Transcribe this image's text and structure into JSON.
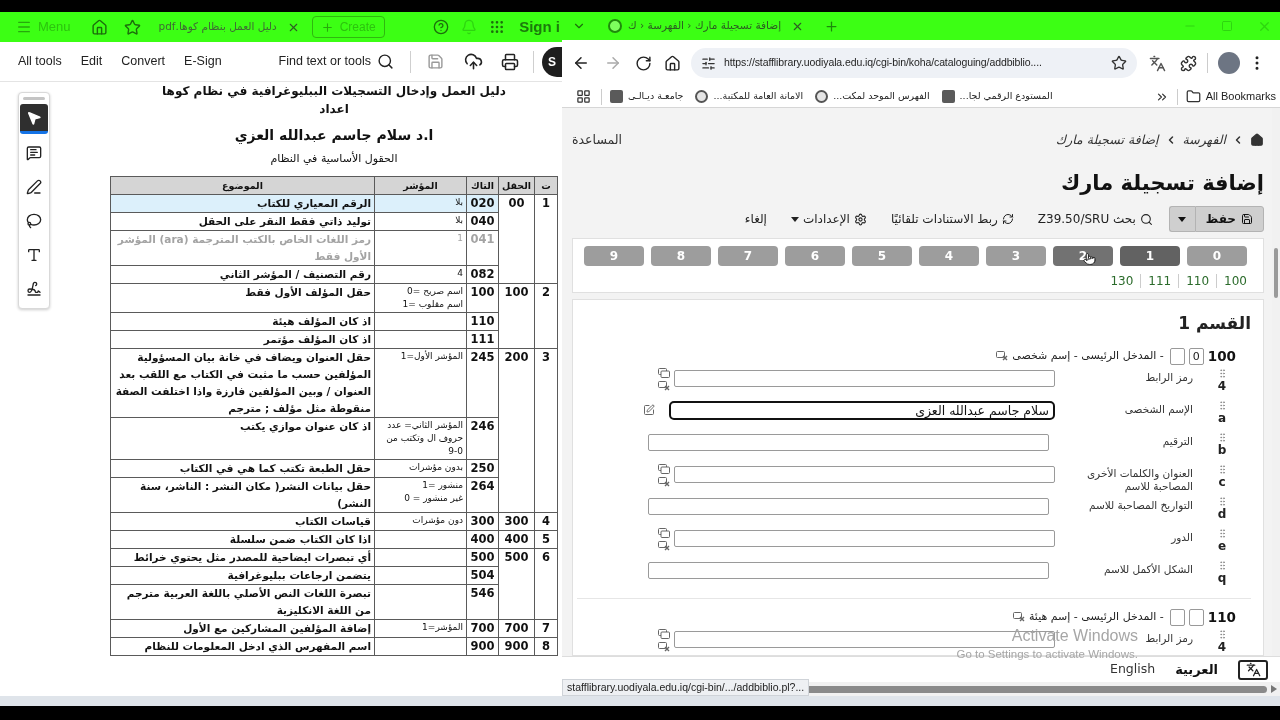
{
  "acrobat": {
    "tab_bar": {
      "menu_label": "Menu",
      "tab_title": "دليل العمل بنظام كوها.pdf",
      "create_label": "Create",
      "sign_in_label": "Sign i"
    },
    "toolbar": {
      "all_tools": "All tools",
      "edit": "Edit",
      "convert": "Convert",
      "e_sign": "E-Sign",
      "search_label": "Find text or tools",
      "account_initial": "S"
    },
    "tools": [
      {
        "kind": "select",
        "selected": true
      },
      {
        "kind": "comment",
        "selected": false
      },
      {
        "kind": "draw",
        "selected": false
      },
      {
        "kind": "lasso",
        "selected": false
      },
      {
        "kind": "text",
        "selected": false
      },
      {
        "kind": "sign",
        "selected": false
      }
    ],
    "document": {
      "title": "دليل العمل وإدخال التسجيلات الببليوغرافية في نظام كوها",
      "prepared_by": "اعداد",
      "author": "ا.د سلام جاسم عبدالله العزي",
      "subtitle": "الحقول الأساسية في النظام",
      "table": {
        "columns": [
          "ت",
          "الحقل",
          "التاك",
          "المؤشر",
          "الموضوع"
        ],
        "groups": [
          {
            "number": "1",
            "field": "00",
            "rows": [
              {
                "tag": "020",
                "indicator": [
                  "بلا"
                ],
                "subject": "الرقم المعياري للكتاب",
                "highlighted": true,
                "faded": false
              },
              {
                "tag": "040",
                "indicator": [
                  "بلا"
                ],
                "subject": "توليد ذاتي فقط النقر على الحقل",
                "highlighted": false,
                "faded": false
              },
              {
                "tag": "041",
                "indicator": [
                  "1"
                ],
                "subject": "رمز اللغات الخاص بالكتب المترجمة (ara) المؤشر الأول فقط",
                "highlighted": false,
                "faded": true
              },
              {
                "tag": "082",
                "indicator": [
                  "4"
                ],
                "subject": "رقم التصنيف / المؤشر الثاني",
                "highlighted": false,
                "faded": false
              }
            ]
          },
          {
            "number": "2",
            "field": "100",
            "rows": [
              {
                "tag": "100",
                "indicator": [
                  "0= اسم صريح",
                  "1= اسم مقلوب"
                ],
                "subject": "حقل المؤلف الأول فقط",
                "highlighted": false,
                "faded": false
              },
              {
                "tag": "110",
                "subject": "اذ كان المؤلف هيئة",
                "highlighted": false,
                "faded": false
              },
              {
                "tag": "111",
                "subject": "اذ كان المؤلف مؤتمر",
                "highlighted": false,
                "faded": false
              }
            ]
          },
          {
            "number": "3",
            "field": "200",
            "rows": [
              {
                "tag": "245",
                "indicator": [
                  "المؤشر الأول=1"
                ],
                "subject": "حقل العنوان ويضاف في خانة بيان المسؤولية المؤلفين حسب ما مثبت في الكتاب مع اللقب بعد العنوان / وبين المؤلفين فارزة واذا اختلفت الصفة منقوطة مثل مؤلف ; مترجم",
                "highlighted": false,
                "faded": false
              },
              {
                "tag": "246",
                "indicator": [
                  "المؤشر الثاني= عدد حروف ال وتكتب من 0-9"
                ],
                "subject": "اذ كان عنوان موازي يكتب",
                "highlighted": false,
                "faded": false
              },
              {
                "tag": "250",
                "indicator": [
                  "بدون مؤشرات"
                ],
                "subject": "حقل الطبعة تكتب كما هي في الكتاب",
                "highlighted": false,
                "faded": false
              },
              {
                "tag": "264",
                "indicator": [
                  "1= منشور",
                  "0 = غير منشور"
                ],
                "subject": "حقل بيانات النشر( مكان النشر : الناشر، سنة النشر)",
                "highlighted": false,
                "faded": false
              }
            ]
          },
          {
            "number": "4",
            "field": "300",
            "rows": [
              {
                "tag": "300",
                "indicator": [
                  "دون مؤشرات"
                ],
                "subject": "قياسات الكتاب",
                "highlighted": false,
                "faded": false
              }
            ]
          },
          {
            "number": "5",
            "field": "400",
            "rows": [
              {
                "tag": "400",
                "subject": "اذا كان الكتاب ضمن سلسلة",
                "highlighted": false,
                "faded": false
              }
            ]
          },
          {
            "number": "6",
            "field": "500",
            "rows": [
              {
                "tag": "500",
                "subject": "أي تبصرات ايضاحية للمصدر مثل يحتوي خرائط",
                "highlighted": false,
                "faded": false
              },
              {
                "tag": "504",
                "subject": "يتضمن ارجاعات ببليوغرافية",
                "highlighted": false,
                "faded": false
              },
              {
                "tag": "546",
                "subject": "تبصرة اللغات النص الأصلي باللغة العربية مترجم من اللغة الانكليزية",
                "highlighted": false,
                "faded": false
              }
            ]
          },
          {
            "number": "7",
            "field": "700",
            "rows": [
              {
                "tag": "700",
                "indicator": [
                  "المؤشر=1"
                ],
                "subject": "إضافة المؤلفين المشاركين مع الأول",
                "highlighted": false,
                "faded": false
              }
            ]
          },
          {
            "number": "8",
            "field": "900",
            "rows": [
              {
                "tag": "900",
                "subject": "اسم المفهرس الذي ادخل المعلومات للنظام",
                "highlighted": false,
                "faded": false
              }
            ]
          }
        ]
      }
    }
  },
  "browser": {
    "tab_title": "إضافة تسجيلة مارك ‹ الفهرسة ‹ ك",
    "url": "https://stafflibrary.uodiyala.edu.iq/cgi-bin/koha/cataloguing/addbiblio....",
    "bookmarks": {
      "university": {
        "label": "جامعـة ديـالـى",
        "kind": "image"
      },
      "secretariat": {
        "label": "الامانة العامة للمكتبة...",
        "kind": "badge"
      },
      "union_catalog": {
        "label": "الفهرس الموحد لمكت...",
        "kind": "badge"
      },
      "repository": {
        "label": "المستودع الرقمي لجا...",
        "kind": "image"
      }
    },
    "all_bookmarks": "All Bookmarks",
    "status_url": "stafflibrary.uodiyala.edu.iq/cgi-bin/.../addbiblio.pl?..."
  },
  "page": {
    "help_link": "المساعدة",
    "breadcrumbs": [
      "الفهرسة",
      "إضافة تسجيلة مارك"
    ],
    "heading": "إضافة تسجيلة مارك",
    "toolbar": {
      "save": "حفظ",
      "z3950_search": "بحث Z39.50/SRU",
      "link_authorities": "ربط الاستنادات تلقائيًا",
      "settings": "الإعدادات",
      "cancel": "إلغاء"
    },
    "tabs": [
      {
        "label": "0",
        "selected": false,
        "hovered": false
      },
      {
        "label": "1",
        "selected": true,
        "hovered": false
      },
      {
        "label": "2",
        "selected": false,
        "hovered": true
      },
      {
        "label": "3",
        "selected": false,
        "hovered": false
      },
      {
        "label": "4",
        "selected": false,
        "hovered": false
      },
      {
        "label": "5",
        "selected": false,
        "hovered": false
      },
      {
        "label": "6",
        "selected": false,
        "hovered": false
      },
      {
        "label": "7",
        "selected": false,
        "hovered": false
      },
      {
        "label": "8",
        "selected": false,
        "hovered": false
      },
      {
        "label": "9",
        "selected": false,
        "hovered": false
      }
    ],
    "field_links": [
      "100",
      "110",
      "111",
      "130"
    ],
    "section_title": "القسم 1",
    "fields": [
      {
        "tag": "100",
        "indicator_1": "0",
        "title": "- المدخل الرئيسى - إسم شخصى",
        "subfields": [
          {
            "code": "4",
            "label": "رمز الرابط",
            "kind": "repeatable",
            "focused": false
          },
          {
            "code": "a",
            "label": "الإسم الشخصى",
            "kind": "linked",
            "value": "سلام جاسم عبدالله العزى",
            "focused": true
          },
          {
            "code": "b",
            "label": "الترقيم",
            "kind": "plain",
            "focused": false
          },
          {
            "code": "c",
            "label": "العنوان والكلمات الأخرى المصاحبة للاسم",
            "kind": "repeatable",
            "focused": false
          },
          {
            "code": "d",
            "label": "التواريخ المصاحبة للاسم",
            "kind": "plain",
            "focused": false
          },
          {
            "code": "e",
            "label": "الدور",
            "kind": "repeatable",
            "focused": false
          },
          {
            "code": "q",
            "label": "الشكل الأكمل للاسم",
            "kind": "plain",
            "focused": false
          }
        ]
      },
      {
        "tag": "110",
        "title": "- المدخل الرئيسى - إسم هيئة",
        "subfields": [
          {
            "code": "4",
            "label": "رمز الرابط",
            "kind": "repeatable",
            "focused": false
          }
        ]
      }
    ],
    "languages": [
      {
        "label": "العربية",
        "selected": true
      },
      {
        "label": "English",
        "selected": false
      }
    ]
  },
  "os_notice": {
    "title": "Activate Windows",
    "detail": "Go to Settings to activate Windows."
  }
}
